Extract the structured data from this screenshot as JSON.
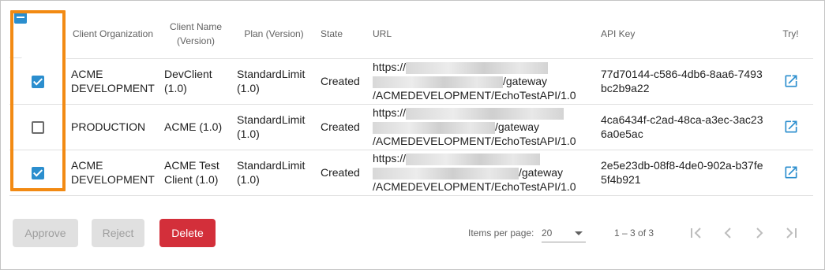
{
  "table": {
    "headers": {
      "client_org": "Client Organization",
      "client_name": "Client Name (Version)",
      "plan": "Plan (Version)",
      "state": "State",
      "url": "URL",
      "api_key": "API Key",
      "try": "Try!"
    },
    "rows": [
      {
        "checked": true,
        "org": "ACME DEVELOPMENT",
        "name": "DevClient (1.0)",
        "plan": "StandardLimit (1.0)",
        "state": "Created",
        "url_prefix": "https://",
        "url_mid": "/gateway",
        "url_path": "/ACMEDEVELOPMENT/EchoTestAPI/1.0",
        "api_key": "77d70144-c586-4db6-8aa6-7493bc2b9a22"
      },
      {
        "checked": false,
        "org": "PRODUCTION",
        "name": "ACME (1.0)",
        "plan": "StandardLimit (1.0)",
        "state": "Created",
        "url_prefix": "https://",
        "url_mid": "/gateway",
        "url_path": "/ACMEDEVELOPMENT/EchoTestAPI/1.0",
        "api_key": "4ca6434f-c2ad-48ca-a3ec-3ac236a0e5ac"
      },
      {
        "checked": true,
        "org": "ACME DEVELOPMENT",
        "name": "ACME Test Client (1.0)",
        "plan": "StandardLimit (1.0)",
        "state": "Created",
        "url_prefix": "https://",
        "url_mid": "/gateway",
        "url_path": "/ACMEDEVELOPMENT/EchoTestAPI/1.0",
        "api_key": "2e5e23db-08f8-4de0-902a-b37fe5f4b921"
      }
    ]
  },
  "actions": {
    "approve": "Approve",
    "reject": "Reject",
    "delete": "Delete"
  },
  "pager": {
    "items_per_page_label": "Items per page:",
    "items_per_page_value": "20",
    "range": "1 – 3 of 3"
  },
  "colors": {
    "accent": "#2b8ece",
    "delete": "#d32f3a",
    "highlight": "#f28a13"
  }
}
